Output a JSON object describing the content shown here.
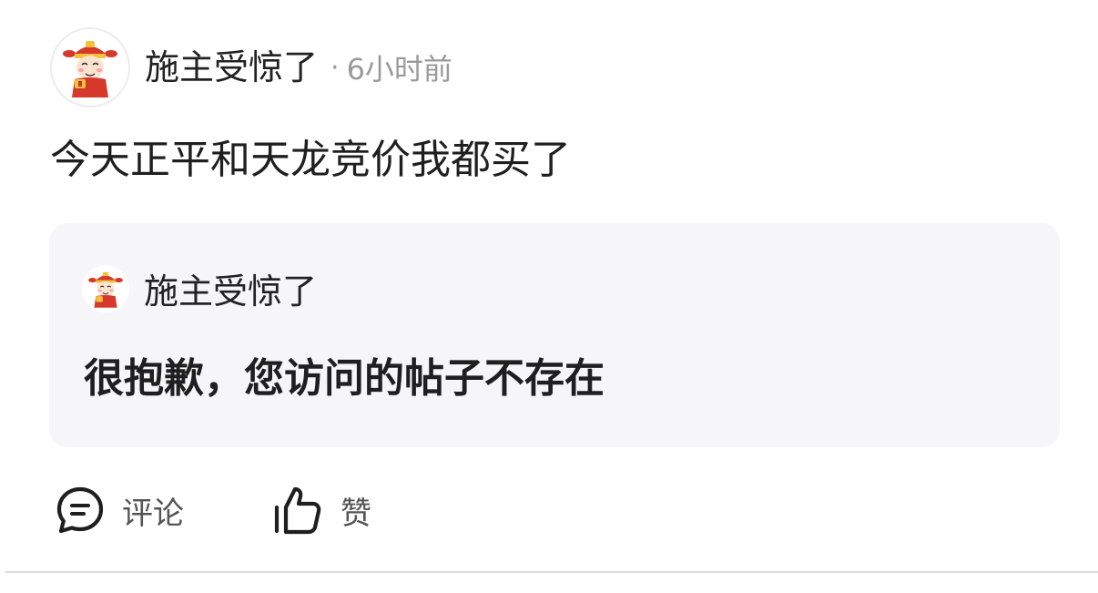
{
  "post": {
    "author": {
      "name": "施主受惊了",
      "avatar_icon": "caishen-avatar-icon"
    },
    "separator": "·",
    "time": "6小时前",
    "content": "今天正平和天龙竞价我都买了"
  },
  "quote": {
    "author": {
      "name": "施主受惊了",
      "avatar_icon": "caishen-avatar-icon"
    },
    "content": "很抱歉，您访问的帖子不存在"
  },
  "actions": {
    "comment": {
      "label": "评论",
      "icon": "comment-bubble-icon"
    },
    "like": {
      "label": "赞",
      "icon": "thumbs-up-icon"
    }
  },
  "colors": {
    "card_bg": "#f6f6f8",
    "muted_text": "#9a9a9a",
    "primary_text": "#1f1f1f",
    "avatar_red": "#d6392b",
    "avatar_gold": "#f2c23a"
  }
}
